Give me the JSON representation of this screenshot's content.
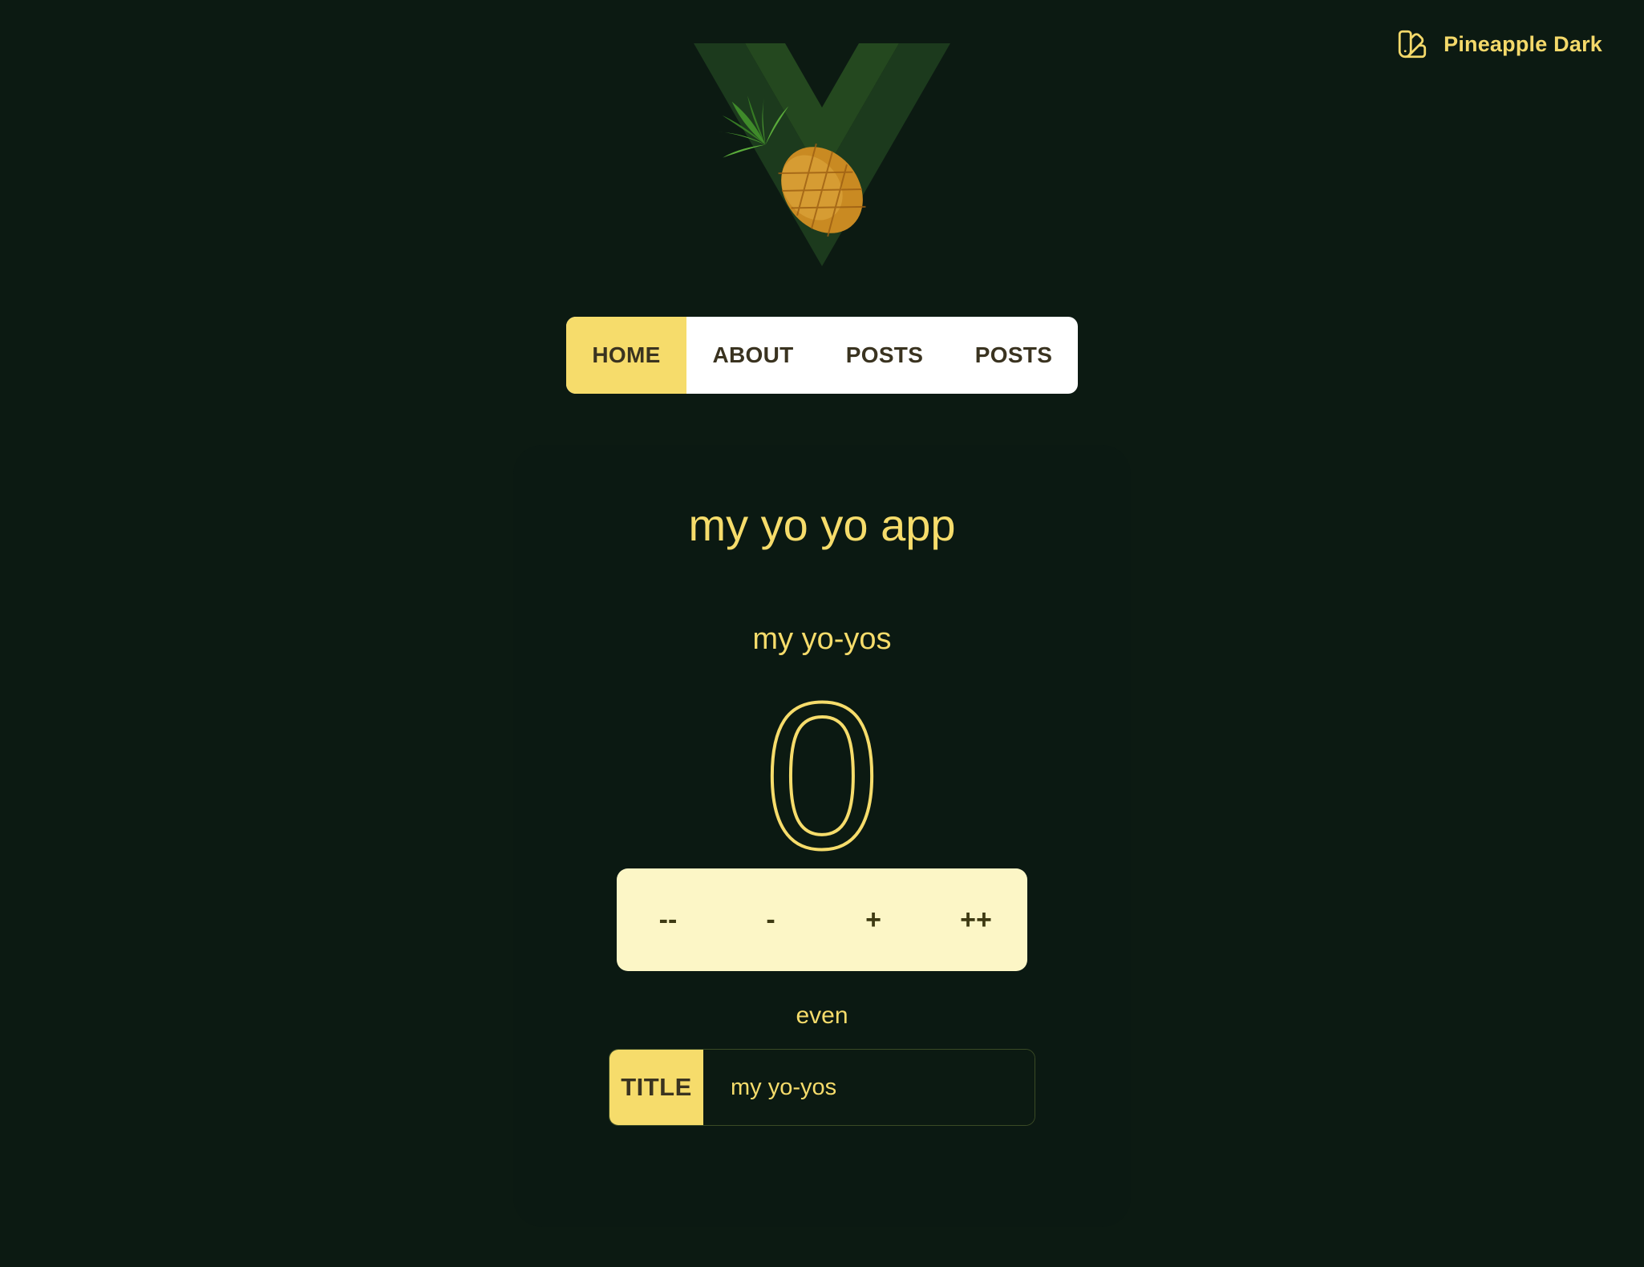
{
  "theme_toggle": {
    "label": "Pineapple Dark",
    "icon": "swatch-book-icon"
  },
  "logo": {
    "icon": "vue-pineapple-logo"
  },
  "nav": {
    "items": [
      {
        "label": "HOME",
        "active": true
      },
      {
        "label": "ABOUT",
        "active": false
      },
      {
        "label": "POSTS",
        "active": false
      },
      {
        "label": "POSTS",
        "active": false
      }
    ]
  },
  "main": {
    "app_title": "my yo yo app",
    "section_title": "my yo-yos",
    "count": "0",
    "buttons": {
      "decrement_twice": "--",
      "decrement": "-",
      "increment": "+",
      "increment_twice": "++"
    },
    "parity": "even",
    "title_field": {
      "label": "TITLE",
      "value": "my yo-yos"
    }
  },
  "colors": {
    "background": "#0c1a12",
    "accent": "#f6dc6b",
    "button_panel": "#fcf6c6",
    "nav_bg": "#ffffff"
  }
}
